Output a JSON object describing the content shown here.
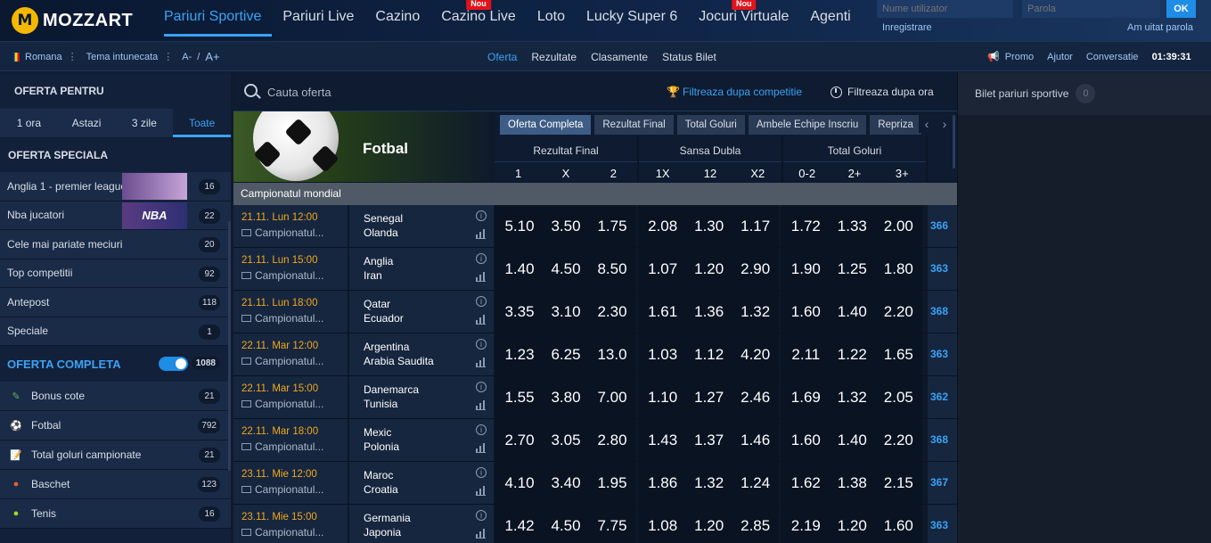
{
  "brand": {
    "name": "MOZZART",
    "logo_letter": "M"
  },
  "nav": {
    "items": [
      {
        "label": "Pariuri Sportive",
        "active": true,
        "badge": ""
      },
      {
        "label": "Pariuri Live",
        "badge": ""
      },
      {
        "label": "Cazino",
        "badge": ""
      },
      {
        "label": "Cazino Live",
        "badge": "Nou"
      },
      {
        "label": "Loto",
        "badge": ""
      },
      {
        "label": "Lucky Super 6",
        "badge": ""
      },
      {
        "label": "Jocuri Virtuale",
        "badge": "Nou"
      },
      {
        "label": "Agenti",
        "badge": ""
      }
    ]
  },
  "login": {
    "username_placeholder": "Nume utilizator",
    "password_placeholder": "Parola",
    "ok_label": "OK",
    "register_label": "Inregistrare",
    "forgot_label": "Am uitat parola"
  },
  "subbar": {
    "language": "Romana",
    "theme": "Tema intunecata",
    "font_small": "A-",
    "font_sep": "/",
    "font_large": "A+",
    "center": [
      {
        "label": "Oferta",
        "active": true
      },
      {
        "label": "Rezultate"
      },
      {
        "label": "Clasamente"
      },
      {
        "label": "Status Bilet"
      }
    ],
    "right": [
      "Promo",
      "Ajutor",
      "Conversatie"
    ],
    "time": "01:39:31"
  },
  "sidebar": {
    "oferta_pentru": "OFERTA PENTRU",
    "tabs": [
      {
        "label": "1 ora"
      },
      {
        "label": "Astazi"
      },
      {
        "label": "3 zile"
      },
      {
        "label": "Toate",
        "active": true
      }
    ],
    "oferta_speciala": "OFERTA SPECIALA",
    "special": [
      {
        "label": "Anglia 1 - premier league...",
        "count": "16",
        "image": ""
      },
      {
        "label": "Nba jucatori",
        "count": "22",
        "image": "NBA"
      },
      {
        "label": "Cele mai pariate meciuri",
        "count": "20"
      },
      {
        "label": "Top competitii",
        "count": "92"
      },
      {
        "label": "Antepost",
        "count": "118"
      },
      {
        "label": "Speciale",
        "count": "1"
      }
    ],
    "oferta_completa": "OFERTA COMPLETA",
    "oferta_completa_count": "1088",
    "sports": [
      {
        "label": "Bonus cote",
        "count": "21",
        "icon": "bonus-icon",
        "color": "#5cb85c"
      },
      {
        "label": "Fotbal",
        "count": "792",
        "icon": "football-icon",
        "color": "#ffffff"
      },
      {
        "label": "Total goluri campionate",
        "count": "21",
        "icon": "notepad-icon",
        "color": "#d9534f"
      },
      {
        "label": "Baschet",
        "count": "123",
        "icon": "basketball-icon",
        "color": "#e8602c"
      },
      {
        "label": "Tenis",
        "count": "16",
        "icon": "tennis-icon",
        "color": "#9bdc28"
      }
    ]
  },
  "main": {
    "search_placeholder": "Cauta oferta",
    "filter_competition": "Filtreaza dupa competitie",
    "filter_time": "Filtreaza dupa ora",
    "sport_title": "Fotbal",
    "market_tabs": [
      "Oferta Completa",
      "Rezultat Final",
      "Total Goluri",
      "Ambele Echipe Inscriu",
      "Repriza"
    ],
    "groups": [
      {
        "title": "Rezultat Final",
        "cols": [
          "1",
          "X",
          "2"
        ]
      },
      {
        "title": "Sansa Dubla",
        "cols": [
          "1X",
          "12",
          "X2"
        ]
      },
      {
        "title": "Total Goluri",
        "cols": [
          "0-2",
          "2+",
          "3+"
        ]
      }
    ],
    "league": "Campionatul mondial",
    "matches": [
      {
        "date": "21.11. Lun 12:00",
        "comp": "Campionatul...",
        "home": "Senegal",
        "away": "Olanda",
        "odds": [
          "5.10",
          "3.50",
          "1.75",
          "2.08",
          "1.30",
          "1.17",
          "1.72",
          "1.33",
          "2.00"
        ],
        "more": "366"
      },
      {
        "date": "21.11. Lun 15:00",
        "comp": "Campionatul...",
        "home": "Anglia",
        "away": "Iran",
        "odds": [
          "1.40",
          "4.50",
          "8.50",
          "1.07",
          "1.20",
          "2.90",
          "1.90",
          "1.25",
          "1.80"
        ],
        "more": "363"
      },
      {
        "date": "21.11. Lun 18:00",
        "comp": "Campionatul...",
        "home": "Qatar",
        "away": "Ecuador",
        "odds": [
          "3.35",
          "3.10",
          "2.30",
          "1.61",
          "1.36",
          "1.32",
          "1.60",
          "1.40",
          "2.20"
        ],
        "more": "368"
      },
      {
        "date": "22.11. Mar 12:00",
        "comp": "Campionatul...",
        "home": "Argentina",
        "away": "Arabia Saudita",
        "odds": [
          "1.23",
          "6.25",
          "13.0",
          "1.03",
          "1.12",
          "4.20",
          "2.11",
          "1.22",
          "1.65"
        ],
        "more": "363"
      },
      {
        "date": "22.11. Mar 15:00",
        "comp": "Campionatul...",
        "home": "Danemarca",
        "away": "Tunisia",
        "odds": [
          "1.55",
          "3.80",
          "7.00",
          "1.10",
          "1.27",
          "2.46",
          "1.69",
          "1.32",
          "2.05"
        ],
        "more": "362"
      },
      {
        "date": "22.11. Mar 18:00",
        "comp": "Campionatul...",
        "home": "Mexic",
        "away": "Polonia",
        "odds": [
          "2.70",
          "3.05",
          "2.80",
          "1.43",
          "1.37",
          "1.46",
          "1.60",
          "1.40",
          "2.20"
        ],
        "more": "368"
      },
      {
        "date": "23.11. Mie 12:00",
        "comp": "Campionatul...",
        "home": "Maroc",
        "away": "Croatia",
        "odds": [
          "4.10",
          "3.40",
          "1.95",
          "1.86",
          "1.32",
          "1.24",
          "1.62",
          "1.38",
          "2.15"
        ],
        "more": "367"
      },
      {
        "date": "23.11. Mie 15:00",
        "comp": "Campionatul...",
        "home": "Germania",
        "away": "Japonia",
        "odds": [
          "1.42",
          "4.50",
          "7.75",
          "1.08",
          "1.20",
          "2.85",
          "2.19",
          "1.20",
          "1.60"
        ],
        "more": "363"
      }
    ]
  },
  "betslip": {
    "title": "Bilet pariuri sportive",
    "count": "0"
  }
}
